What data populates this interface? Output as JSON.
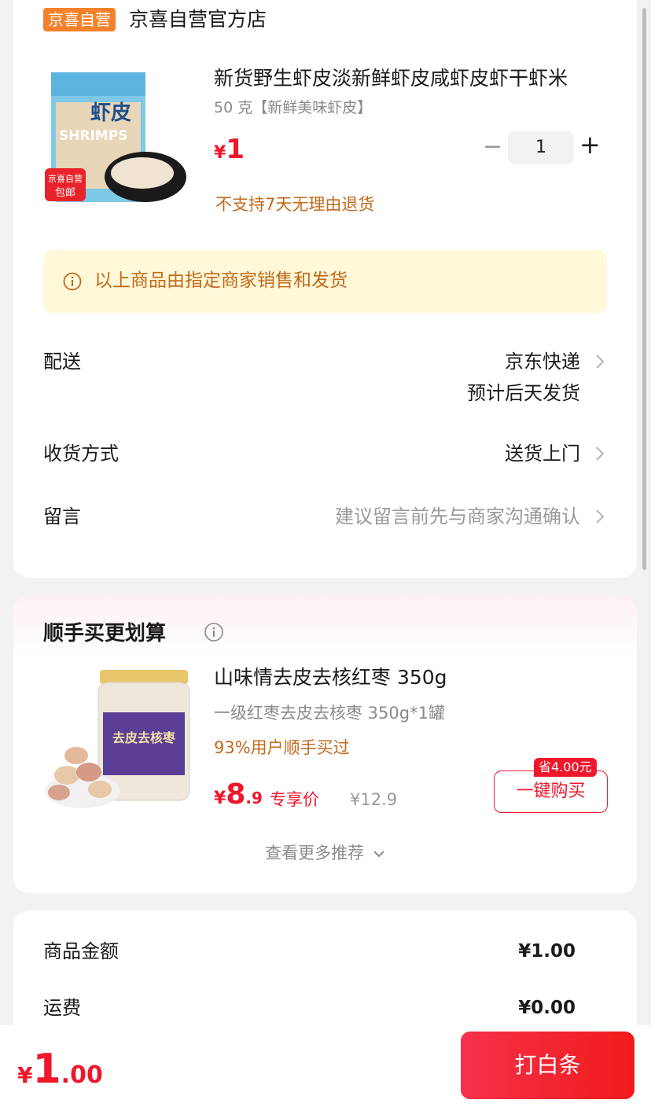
{
  "store": {
    "badge": "京喜自营",
    "name": "京喜自营官方店"
  },
  "product": {
    "title": "新货野生虾皮淡新鲜虾皮咸虾皮虾干虾米",
    "spec": "50 克【新鲜美味虾皮】",
    "currency": "¥",
    "price": "1",
    "quantity": "1",
    "no_return": "不支持7天无理由退货",
    "image_label": "虾皮",
    "image_sub": "SHRIMPS",
    "image_badge_line1": "京喜自营",
    "image_badge_line2": "包邮"
  },
  "notice": "以上商品由指定商家销售和发货",
  "rows": {
    "delivery": {
      "label": "配送",
      "value1": "京东快递",
      "value2": "预计后天发货"
    },
    "receive": {
      "label": "收货方式",
      "value": "送货上门"
    },
    "message": {
      "label": "留言",
      "placeholder": "建议留言前先与商家沟通确认"
    }
  },
  "recommend": {
    "section_title": "顺手买更划算",
    "name": "山味情去皮去核红枣 350g",
    "spec": "一级红枣去皮去核枣 350g*1罐",
    "buyers": "93%用户顺手买过",
    "currency": "¥",
    "price_int": "8",
    "price_dec": ".9",
    "exclusive": "专享价",
    "original_price": "¥12.9",
    "save_badge": "省4.00元",
    "buy_label": "一键购买",
    "more": "查看更多推荐",
    "image_label": "去皮去核枣"
  },
  "summary": {
    "goods_label": "商品金额",
    "goods_value": "¥1.00",
    "shipping_label": "运费",
    "shipping_value": "¥0.00"
  },
  "bottom": {
    "currency": "¥",
    "total_int": "1",
    "total_dec": ".00",
    "pay_label": "打白条"
  },
  "colors": {
    "accent_red": "#f0162b",
    "warning_orange": "#c26a1c",
    "badge_orange": "#f5822a",
    "notice_bg": "#fff8d9"
  }
}
